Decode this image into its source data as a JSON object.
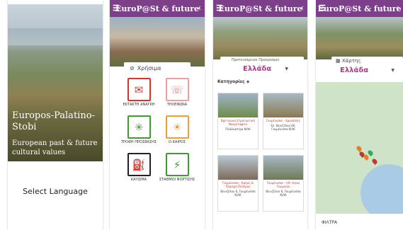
{
  "screen1": {
    "title": "Europos-Palatino-Stobi",
    "subtitle": "European past & future cultural values",
    "select_language": "Select Language"
  },
  "app": {
    "title": "EuroP@St & future"
  },
  "screen2": {
    "useful_label": "Χρήσιμα",
    "tiles": [
      {
        "label": "ΕΚΤΑΚΤΗ ΑΝΑΓΚΗ",
        "icon": "emergency-icon",
        "color": "#d9342b"
      },
      {
        "label": "ΤΗΛΕΦΩΝΑ",
        "icon": "phone-icon",
        "color": "#e8a0a0"
      },
      {
        "label": "ΤΡΟΦΗ ΠΡΟΣΒΑΣΗΣ",
        "icon": "virus-icon",
        "color": "#3e9b2f"
      },
      {
        "label": "Ο ΚΑΙΡΟΣ",
        "icon": "weather-icon",
        "color": "#e8a13a"
      },
      {
        "label": "ΚΑΥΣΙΜΑ",
        "icon": "fuel-icon",
        "color": "#222222"
      },
      {
        "label": "ΣΤΑΘΜΟΙ ΦΟΡΤΙΣΗΣ",
        "icon": "charging-icon",
        "color": "#3e9b2f"
      }
    ]
  },
  "screen3": {
    "hint": "Προτεινόμενοι Προορισμοί",
    "selected": "Ελλάδα",
    "categories_label": "Κατηγορίες",
    "cards": [
      {
        "title": "Βρετανικό Στρατιωτικό Νεκροταφείο",
        "desc": "Πολύκαστρο ΚΙΛΚ"
      },
      {
        "title": "Γουμένισσα - Χρυσάλλις",
        "desc": "Ελ. Βενιζέλου 46, Γουμένισσα ΚΙΛΚ"
      },
      {
        "title": "Γουμένισσα - Κρήνη & Περιοχή Πολέμου",
        "desc": "Βενιζέλου 6, Γουμένισσα ΚΙΛΚ"
      },
      {
        "title": "Γουμένισσα - I.M. Αγίου Γεωργίου",
        "desc": "Βενιζέλου 6, Γουμένισσα ΚΙΛΚ"
      }
    ]
  },
  "screen4": {
    "hint": "Χάρτης",
    "selected": "Ελλάδα",
    "filters_label": "ΦΙΛΤΡΑ"
  }
}
